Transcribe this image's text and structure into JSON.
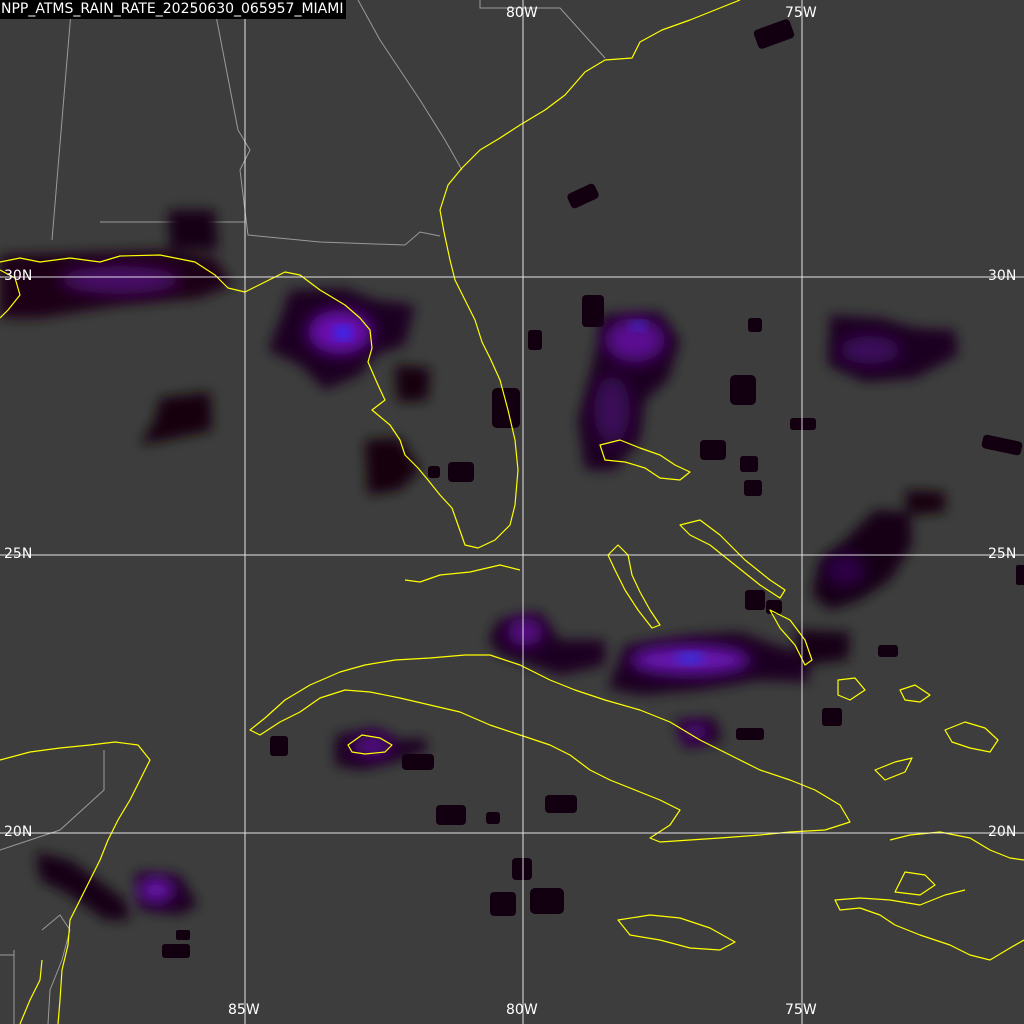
{
  "title": "NPP_ATMS_RAIN_RATE_20250630_065957_MIAMI",
  "colors": {
    "background": "#3d3d3d",
    "grid": "#ffffff",
    "coastline": "#ffff00",
    "borders": "#9a9a9a",
    "rain_low": "#140010",
    "rain_mid": "#6a0aa8",
    "rain_high": "#2a30ff"
  },
  "grid_labels": {
    "top_80w": "80W",
    "top_75w": "75W",
    "left_30n": "30N",
    "right_30n": "30N",
    "left_25n": "25N",
    "right_25n": "25N",
    "left_20n": "20N",
    "right_20n": "20N",
    "bottom_85w": "85W",
    "bottom_80w": "80W",
    "bottom_75w": "75W"
  },
  "rain_cells": [
    {
      "region": "Gulf coast (Louisiana/Mississippi)",
      "intensity": 0.45
    },
    {
      "region": "Florida Big Bend",
      "intensity": 1.0
    },
    {
      "region": "Eastern Gulf",
      "intensity": 0.2
    },
    {
      "region": "SW Florida coast",
      "intensity": 0.2
    },
    {
      "region": "Atlantic east of Florida",
      "intensity": 0.55
    },
    {
      "region": "Atlantic NE",
      "intensity": 0.4
    },
    {
      "region": "Great Bahama Bank / N Cuba",
      "intensity": 0.75
    },
    {
      "region": "Central Bahamas",
      "intensity": 0.35
    },
    {
      "region": "Isle of Youth",
      "intensity": 0.5
    },
    {
      "region": "Yucatan / Belize",
      "intensity": 0.45
    },
    {
      "region": "Caribbean south of Cuba",
      "intensity": 0.25
    }
  ]
}
